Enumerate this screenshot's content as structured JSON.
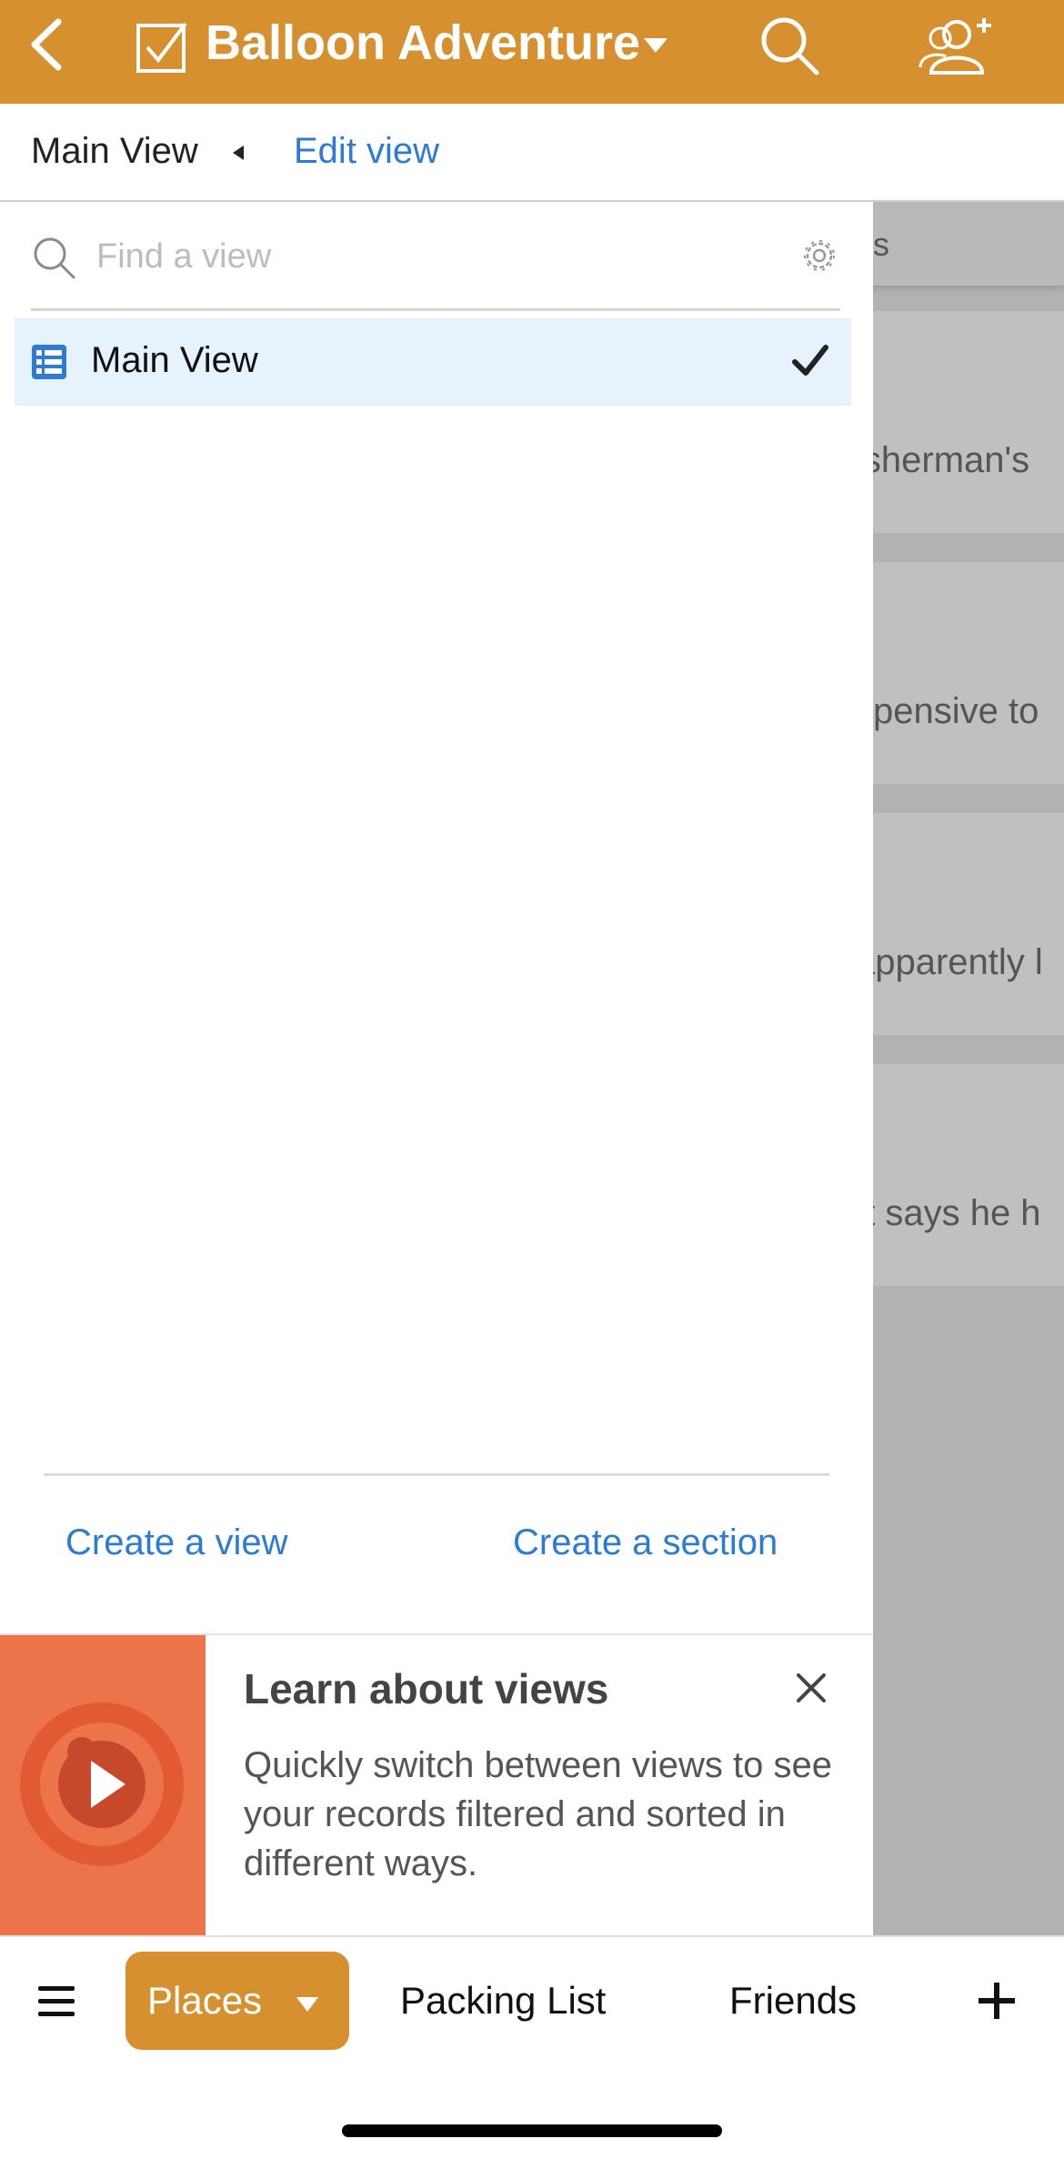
{
  "header": {
    "title": "Balloon Adventure",
    "accent_color": "#D6902F",
    "icons": [
      "back-icon",
      "base-checkbox-icon",
      "chevron-down-icon",
      "search-icon",
      "share-users-icon"
    ]
  },
  "viewbar": {
    "current_view": "Main View",
    "edit_label": "Edit view"
  },
  "background": {
    "header_text": "es",
    "snippets": [
      "isherman's",
      "xpensive to",
      "apparently l",
      "tt says he h"
    ]
  },
  "drawer": {
    "search_placeholder": "Find a view",
    "views": [
      {
        "label": "Main View",
        "selected": true,
        "icon": "grid-view-icon"
      }
    ],
    "create_view_label": "Create a view",
    "create_section_label": "Create a section"
  },
  "promo": {
    "title": "Learn about views",
    "body": "Quickly switch between views to see your records filtered and sorted in different ways.",
    "thumb_color": "#EC744A"
  },
  "tabbar": {
    "active_tab": "Places",
    "tabs": [
      "Packing List",
      "Friends"
    ],
    "link_color": "#2E7BD6"
  }
}
